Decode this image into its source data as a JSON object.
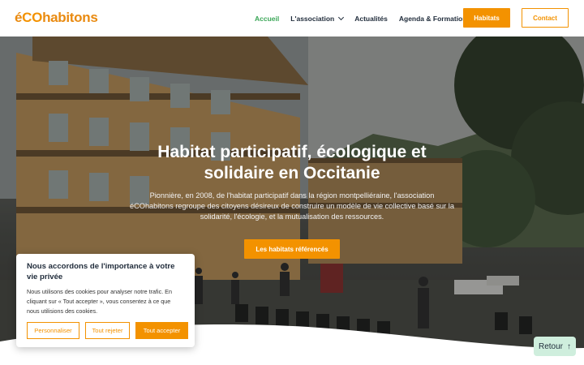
{
  "header": {
    "logo": {
      "small": "é",
      "co": "CO",
      "rest": "habitons"
    },
    "nav": [
      {
        "label": "Accueil",
        "active": true
      },
      {
        "label": "L'association",
        "dropdown": true
      },
      {
        "label": "Actualités"
      },
      {
        "label": "Agenda & Formations"
      }
    ],
    "habitats_label": "Habitats",
    "contact_label": "Contact"
  },
  "hero": {
    "title_line1": "Habitat participatif, écologique et",
    "title_line2": "solidaire en Occitanie",
    "text": "Pionnière, en 2008, de l'habitat participatif dans la région montpelliéraine, l'association éCOhabitons regroupe des citoyens désireux de construire un modèle de vie collective basé sur la solidarité, l'écologie, et la mutualisation des ressources.",
    "cta_label": "Les habitats référencés"
  },
  "cookie": {
    "title": "Nous accordons de l'importance à votre vie privée",
    "text": "Nous utilisons des cookies pour analyser notre trafic. En cliquant sur « Tout accepter », vous consentez à ce que nous utilisions des cookies.",
    "personalize_label": "Personnaliser",
    "reject_label": "Tout rejeter",
    "accept_label": "Tout accepter"
  },
  "retour": {
    "label": "Retour",
    "icon": "arrow-up-icon"
  },
  "colors": {
    "accent": "#f39200",
    "active_nav": "#3aa657",
    "retour_bg": "#cfeedd"
  }
}
